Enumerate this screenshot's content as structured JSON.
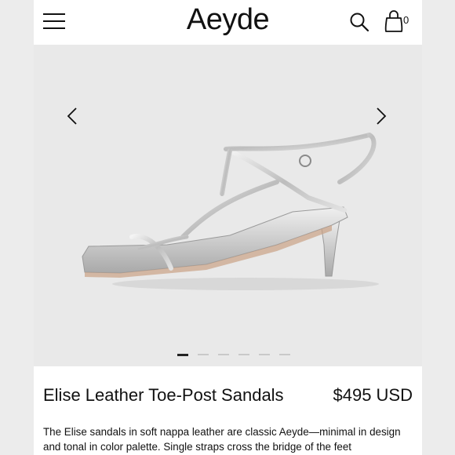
{
  "header": {
    "brand": "Aeyde",
    "menu_icon": "hamburger-menu-icon",
    "search_icon": "search-icon",
    "bag_icon": "shopping-bag-icon",
    "bag_count": "0"
  },
  "gallery": {
    "prev_icon": "chevron-left-icon",
    "next_icon": "chevron-right-icon",
    "slide_count": 6,
    "active_slide": 1,
    "image_description": "silver strappy toe-post sandal with kitten heel"
  },
  "product": {
    "title": "Elise Leather Toe-Post Sandals",
    "price": "$495 USD",
    "description": "The Elise sandals in soft nappa leather are classic Aeyde—minimal in design and tonal in color palette. Single straps cross the bridge of the feet"
  },
  "colors": {
    "background": "#ffffff",
    "gallery_bg": "#e9e9e9",
    "text": "#111111",
    "dot_inactive": "#c9c9c9",
    "dot_active": "#222222"
  }
}
